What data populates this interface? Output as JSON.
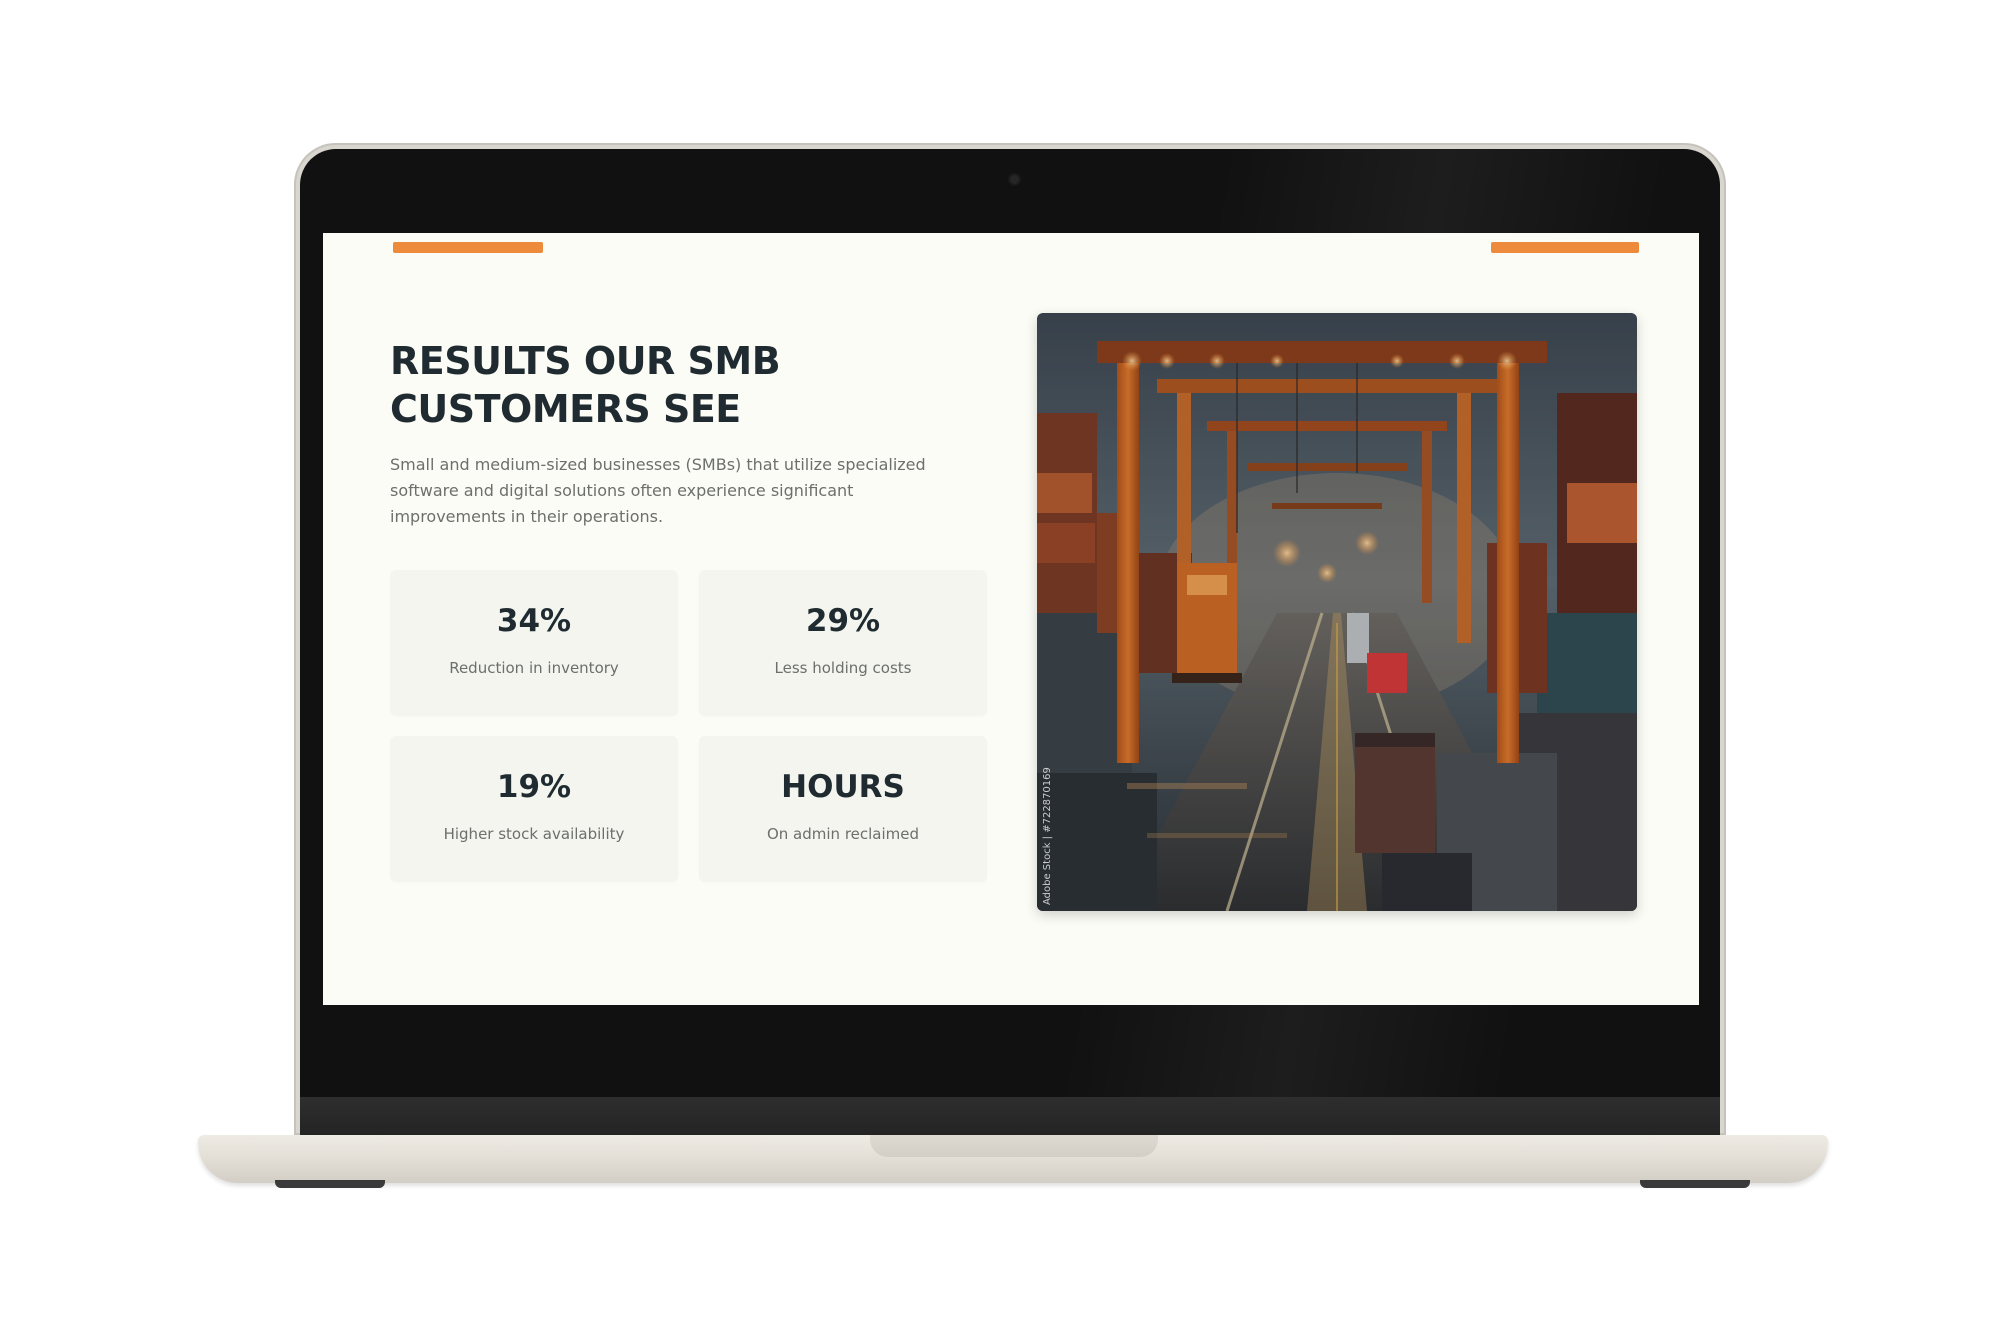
{
  "slide": {
    "title_line1": "RESULTS OUR SMB",
    "title_line2": "CUSTOMERS SEE",
    "description": "Small and medium-sized businesses (SMBs) that utilize specialized software and digital solutions often experience significant improvements in their operations.",
    "stats": [
      {
        "value": "34%",
        "label": "Reduction in inventory"
      },
      {
        "value": "29%",
        "label": "Less holding costs"
      },
      {
        "value": "19%",
        "label": "Higher stock availability"
      },
      {
        "value": "HOURS",
        "label": "On admin reclaimed"
      }
    ],
    "image": {
      "watermark": "Adobe Stock | #722870169"
    }
  },
  "colors": {
    "accent": "#ee8a3c",
    "heading": "#1f2b30",
    "body_text": "#6d6f6c",
    "screen_background": "#fcfcf6",
    "card_background": "#f4f5ef"
  }
}
